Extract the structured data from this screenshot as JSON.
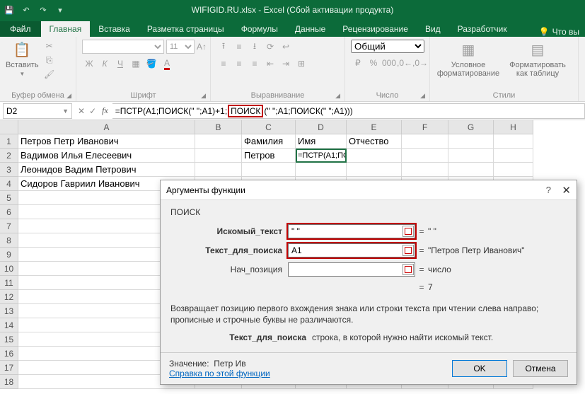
{
  "titlebar": {
    "title": "WIFIGID.RU.xlsx - Excel (Сбой активации продукта)"
  },
  "tabs": {
    "file": "Файл",
    "items": [
      "Главная",
      "Вставка",
      "Разметка страницы",
      "Формулы",
      "Данные",
      "Рецензирование",
      "Вид",
      "Разработчик"
    ],
    "tell": "Что вы"
  },
  "ribbon": {
    "clipboard": {
      "paste": "Вставить",
      "label": "Буфер обмена"
    },
    "font": {
      "label": "Шрифт",
      "size": "11"
    },
    "align": {
      "label": "Выравнивание"
    },
    "number": {
      "format": "Общий",
      "label": "Число"
    },
    "styles": {
      "cond": "Условное форматирование",
      "table": "Форматировать как таблицу",
      "label": "Стили"
    }
  },
  "namebox": "D2",
  "formula": {
    "pre": "=ПСТР(A1;ПОИСК(\" \";A1)+1;",
    "hl": "ПОИСК",
    "post": "(\" \";A1;ПОИСК(\" \";A1)))"
  },
  "columns": [
    "A",
    "B",
    "C",
    "D",
    "E",
    "F",
    "G",
    "H"
  ],
  "rows": [
    {
      "n": "1",
      "A": "Петров Петр Иванович",
      "C": "Фамилия",
      "D": "Имя",
      "E": "Отчество"
    },
    {
      "n": "2",
      "A": "Вадимов Илья Елесеевич",
      "C": "Петров",
      "D_formula": "=ПСТР(A1;ПОИСК(\" \";A1)+1;ПОИСК(\" \";A1;ПОИСК(\" \";A1)))"
    },
    {
      "n": "3",
      "A": "Леонидов Вадим Петрович"
    },
    {
      "n": "4",
      "A": "Сидоров Гавриил Иванович"
    },
    {
      "n": "5"
    },
    {
      "n": "6"
    },
    {
      "n": "7"
    },
    {
      "n": "8"
    },
    {
      "n": "9"
    },
    {
      "n": "10"
    },
    {
      "n": "11"
    },
    {
      "n": "12"
    },
    {
      "n": "13"
    },
    {
      "n": "14"
    },
    {
      "n": "15"
    },
    {
      "n": "16"
    },
    {
      "n": "17"
    },
    {
      "n": "18"
    }
  ],
  "dialog": {
    "title": "Аргументы функции",
    "func": "ПОИСК",
    "args": [
      {
        "label": "Искомый_текст",
        "value": "\" \"",
        "result": "\" \"",
        "bold": true,
        "hl": true
      },
      {
        "label": "Текст_для_поиска",
        "value": "A1",
        "result": "\"Петров Петр Иванович\"",
        "bold": true,
        "hl": true
      },
      {
        "label": "Нач_позиция",
        "value": "",
        "result": "число",
        "bold": false,
        "hl": false
      }
    ],
    "eq_result": "7",
    "desc": "Возвращает позицию первого вхождения знака или строки текста при чтении слева направо; прописные и строчные буквы не различаются.",
    "argdesc_key": "Текст_для_поиска",
    "argdesc_val": "строка, в которой нужно найти искомый текст.",
    "value_label": "Значение:",
    "value": "Петр Ив",
    "help": "Справка по этой функции",
    "ok": "OK",
    "cancel": "Отмена"
  }
}
